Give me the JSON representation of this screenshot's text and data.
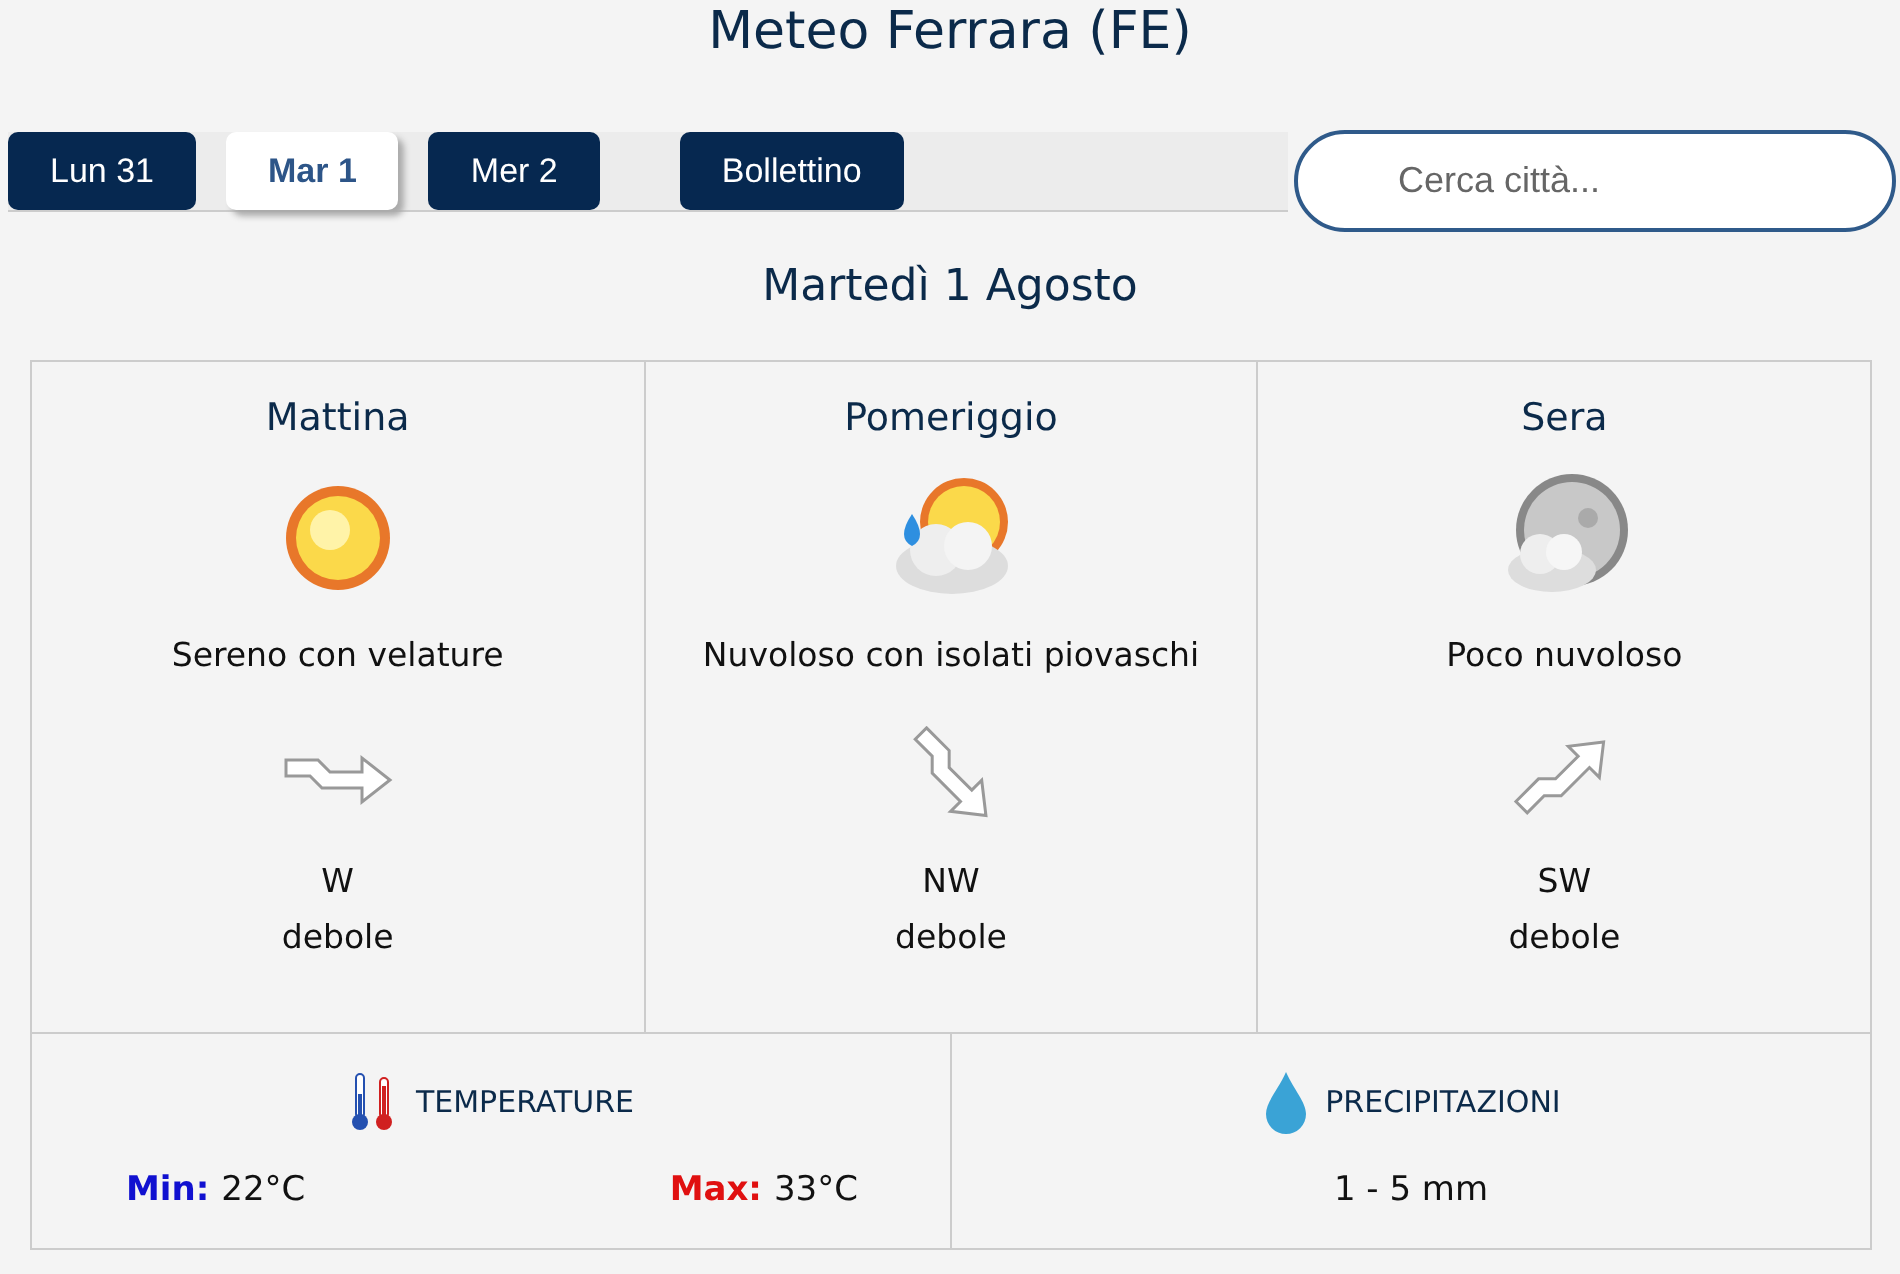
{
  "title": "Meteo Ferrara (FE)",
  "tabs": [
    {
      "label": "Lun 31",
      "kind": "day",
      "selected": false
    },
    {
      "label": "Mar 1",
      "kind": "day",
      "selected": true
    },
    {
      "label": "Mer 2",
      "kind": "day",
      "selected": false
    },
    {
      "label": "Bollettino",
      "kind": "bulletin",
      "selected": false
    }
  ],
  "search": {
    "placeholder": "Cerca città..."
  },
  "day_title": "Martedì 1 Agosto",
  "periods": [
    {
      "name": "Mattina",
      "kind": "sun",
      "description": "Sereno con velature",
      "wind_arrow": {
        "kind": "west"
      },
      "wind_direction": "W",
      "wind_strength": "debole"
    },
    {
      "name": "Pomeriggio",
      "kind": "showers",
      "description": "Nuvoloso con isolati piovaschi",
      "wind_arrow": {
        "kind": "northwest"
      },
      "wind_direction": "NW",
      "wind_strength": "debole"
    },
    {
      "name": "Sera",
      "kind": "night",
      "description": "Poco nuvoloso",
      "wind_arrow": {
        "kind": "southwest"
      },
      "wind_direction": "SW",
      "wind_strength": "debole"
    }
  ],
  "temperature": {
    "heading": "TEMPERATURE",
    "min_label": "Min:",
    "min": "22°C",
    "max_label": "Max:",
    "max": "33°C"
  },
  "precipitation": {
    "heading": "PRECIPITAZIONI",
    "value": "1 - 5 mm"
  }
}
